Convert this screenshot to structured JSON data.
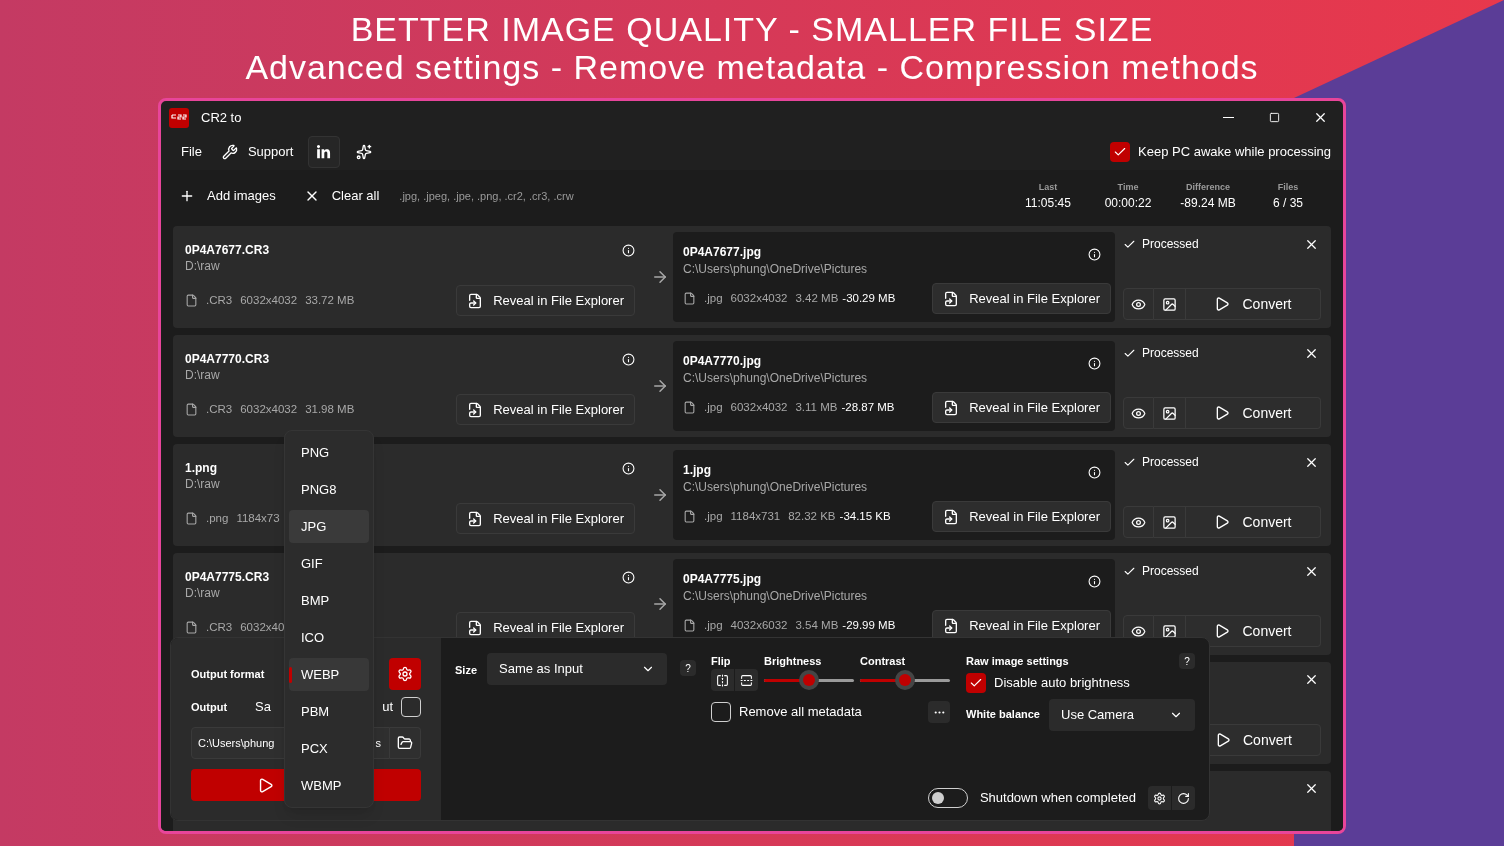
{
  "headline": [
    "BETTER IMAGE QUALITY - SMALLER FILE SIZE",
    "Advanced settings - Remove metadata - Compression methods"
  ],
  "window": {
    "title": "CR2 to"
  },
  "menu": [
    {
      "kind": "text",
      "label": "File"
    },
    {
      "kind": "wrench",
      "label": "Support"
    },
    {
      "kind": "linkedin"
    },
    {
      "kind": "sparkle"
    }
  ],
  "keep_awake": {
    "label": "Keep PC awake while processing",
    "checked": true
  },
  "toolbar": {
    "add": "Add images",
    "clear": "Clear all",
    "extensions": ".jpg, .jpeg, .jpe, .png, .cr2, .cr3, .crw"
  },
  "stats": [
    {
      "label": "Last",
      "value": "11:05:45"
    },
    {
      "label": "Time",
      "value": "00:00:22"
    },
    {
      "label": "Difference",
      "value": "-89.24 MB"
    },
    {
      "label": "Files",
      "value": "6 / 35"
    }
  ],
  "files": [
    {
      "kind": "full",
      "source": {
        "name": "0P4A7677.CR3",
        "folder": "D:\\raw",
        "ext": ".CR3",
        "dims": "6032x4032",
        "size": "33.72 MB",
        "reveal": "Reveal in File Explorer"
      },
      "output": {
        "name": "0P4A7677.jpg",
        "folder": "C:\\Users\\phung\\OneDrive\\Pictures",
        "ext": ".jpg",
        "dims": "6032x4032",
        "size": "3.42 MB",
        "diff": "-30.29 MB",
        "reveal": "Reveal in File Explorer"
      },
      "status": "Processed",
      "convert": "Convert"
    },
    {
      "kind": "full",
      "source": {
        "name": "0P4A7770.CR3",
        "folder": "D:\\raw",
        "ext": ".CR3",
        "dims": "6032x4032",
        "size": "31.98 MB",
        "reveal": "Reveal in File Explorer"
      },
      "output": {
        "name": "0P4A7770.jpg",
        "folder": "C:\\Users\\phung\\OneDrive\\Pictures",
        "ext": ".jpg",
        "dims": "6032x4032",
        "size": "3.11 MB",
        "diff": "-28.87 MB",
        "reveal": "Reveal in File Explorer"
      },
      "status": "Processed",
      "convert": "Convert"
    },
    {
      "kind": "full",
      "source": {
        "name": "1.png",
        "folder": "D:\\raw",
        "ext": ".png",
        "dims": "1184x73",
        "reveal": "Reveal in File Explorer"
      },
      "output": {
        "name": "1.jpg",
        "folder": "C:\\Users\\phung\\OneDrive\\Pictures",
        "ext": ".jpg",
        "dims": "1184x731",
        "size": "82.32 KB",
        "diff": "-34.15 KB",
        "reveal": "Reveal in File Explorer"
      },
      "status": "Processed",
      "convert": "Convert"
    },
    {
      "kind": "full",
      "source": {
        "name": "0P4A7775.CR3",
        "folder": "D:\\raw",
        "ext": ".CR3",
        "dims": "6032x40",
        "reveal": "Reveal in File Explorer"
      },
      "output": {
        "name": "0P4A7775.jpg",
        "folder": "C:\\Users\\phung\\OneDrive\\Pictures",
        "ext": ".jpg",
        "dims": "4032x6032",
        "size": "3.54 MB",
        "diff": "-29.99 MB",
        "reveal": "Reveal in File Explorer"
      },
      "status": "Processed",
      "convert": "Convert"
    },
    {
      "kind": "covered",
      "convert": "Convert"
    },
    {
      "kind": "covered"
    }
  ],
  "format_menu": [
    {
      "label": "PNG",
      "selected": false,
      "highlighted": false
    },
    {
      "label": "PNG8",
      "selected": false,
      "highlighted": false
    },
    {
      "label": "JPG",
      "selected": false,
      "highlighted": true
    },
    {
      "label": "GIF",
      "selected": false,
      "highlighted": false
    },
    {
      "label": "BMP",
      "selected": false,
      "highlighted": false
    },
    {
      "label": "ICO",
      "selected": false,
      "highlighted": false
    },
    {
      "label": "WEBP",
      "selected": true,
      "highlighted": false
    },
    {
      "label": "PBM",
      "selected": false,
      "highlighted": false
    },
    {
      "label": "PCX",
      "selected": false,
      "highlighted": false
    },
    {
      "label": "WBMP",
      "selected": false,
      "highlighted": false
    }
  ],
  "output_panel": {
    "format_label": "Output format",
    "output_label": "Output",
    "same_fragments": [
      "Sa",
      "ut"
    ],
    "same_checked": false,
    "path_fragments": [
      "C:\\Users\\phung",
      "s"
    ]
  },
  "settings": {
    "size_label": "Size",
    "size_value": "Same as Input",
    "size_help": "?",
    "flip_label": "Flip",
    "sliders": [
      {
        "label": "Brightness",
        "level": 0.5
      },
      {
        "label": "Contrast",
        "level": 0.5
      }
    ],
    "metadata": {
      "label": "Remove all metadata",
      "checked": false
    },
    "raw": {
      "title": "Raw image settings",
      "help": "?",
      "auto_brightness": {
        "label": "Disable auto brightness",
        "checked": true
      },
      "white_balance_label": "White balance",
      "white_balance": "Use Camera"
    },
    "shutdown": {
      "label": "Shutdown when completed",
      "on": false
    }
  }
}
